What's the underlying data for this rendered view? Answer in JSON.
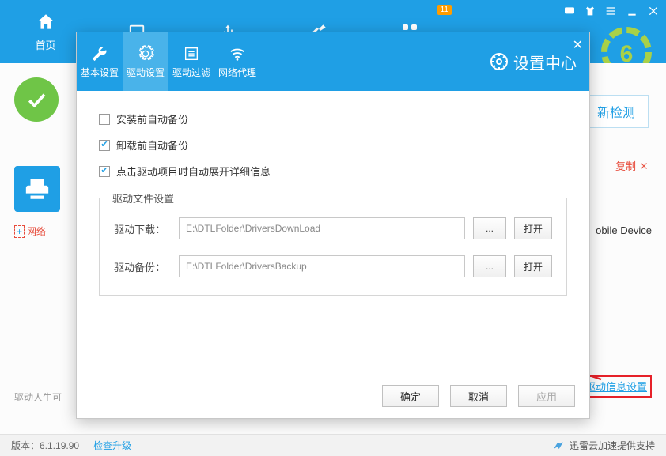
{
  "header": {
    "home_label": "首页",
    "badge": "11"
  },
  "bg": {
    "refresh_btn": "新检测",
    "copy": "复制",
    "net_cfg": "网络",
    "mobile": "obile Device",
    "settings_link": "驱动信息设置",
    "footer_text": "驱动人生可"
  },
  "dialog": {
    "tabs": {
      "basic": "基本设置",
      "driver": "驱动设置",
      "filter": "驱动过滤",
      "proxy": "网络代理"
    },
    "title": "设置中心",
    "chk1": "安装前自动备份",
    "chk2": "卸载前自动备份",
    "chk3": "点击驱动项目时自动展开详细信息",
    "fieldset_legend": "驱动文件设置",
    "download_label": "驱动下载：",
    "download_path": "E:\\DTLFolder\\DriversDownLoad",
    "backup_label": "驱动备份：",
    "backup_path": "E:\\DTLFolder\\DriversBackup",
    "browse": "...",
    "open": "打开",
    "ok": "确定",
    "cancel": "取消",
    "apply": "应用"
  },
  "status": {
    "version": "版本：6.1.19.90",
    "update": "检查升级",
    "accel": "迅雷云加速提供支持"
  }
}
